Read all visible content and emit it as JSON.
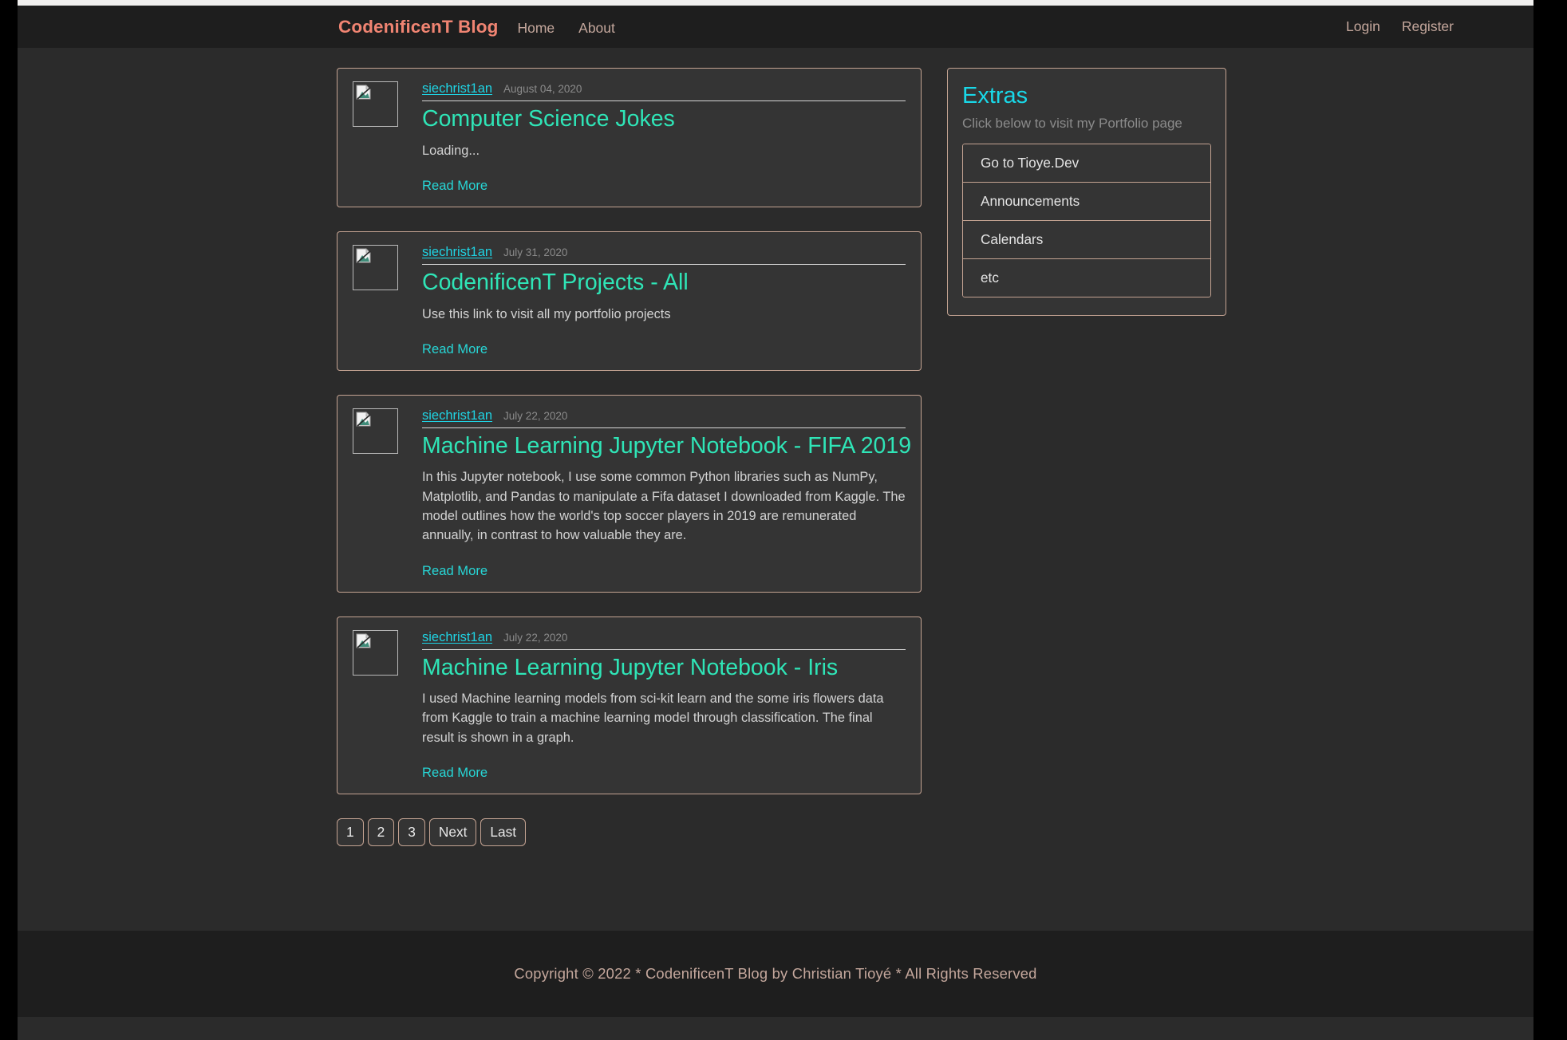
{
  "navbar": {
    "brand": "CodenificenT Blog",
    "left_links": [
      {
        "label": "Home",
        "name": "nav-link-home"
      },
      {
        "label": "About",
        "name": "nav-link-about"
      }
    ],
    "right_links": [
      {
        "label": "Login",
        "name": "nav-link-login"
      },
      {
        "label": "Register",
        "name": "nav-link-register"
      }
    ],
    "brand_color": "#f08472",
    "link_color": "#c4a79c",
    "background": "#1e1e1e"
  },
  "posts": [
    {
      "author": "siechrist1an",
      "date": "August 04, 2020",
      "title": "Computer Science Jokes",
      "excerpt": "Loading...",
      "read_more": "Read More",
      "thumbnail": "broken-image-icon"
    },
    {
      "author": "siechrist1an",
      "date": "July 31, 2020",
      "title": "CodenificenT Projects - All",
      "excerpt": "Use this link to visit all my portfolio projects",
      "read_more": "Read More",
      "thumbnail": "broken-image-icon"
    },
    {
      "author": "siechrist1an",
      "date": "July 22, 2020",
      "title": "Machine Learning Jupyter Notebook - FIFA 2019",
      "excerpt": "In this Jupyter notebook, I use some common Python libraries such as NumPy, Matplotlib, and Pandas to manipulate a Fifa dataset I downloaded from Kaggle. The model outlines how the world's top soccer players in 2019 are remunerated annually, in contrast to how valuable they are.",
      "read_more": "Read More",
      "thumbnail": "broken-image-icon"
    },
    {
      "author": "siechrist1an",
      "date": "July 22, 2020",
      "title": "Machine Learning Jupyter Notebook - Iris",
      "excerpt": "I used Machine learning models from sci-kit learn and the some iris flowers data from Kaggle to train a machine learning model through classification. The final result is shown in a graph.",
      "read_more": "Read More",
      "thumbnail": "broken-image-icon"
    }
  ],
  "pagination": {
    "buttons": [
      {
        "label": "1",
        "name": "page-1"
      },
      {
        "label": "2",
        "name": "page-2"
      },
      {
        "label": "3",
        "name": "page-3"
      },
      {
        "label": "Next",
        "name": "page-next"
      },
      {
        "label": "Last",
        "name": "page-last"
      }
    ]
  },
  "sidebar": {
    "title": "Extras",
    "subtitle": "Click below to visit my Portfolio page",
    "items": [
      {
        "label": "Go to Tioye.Dev",
        "name": "extras-item-tioye-dev"
      },
      {
        "label": "Announcements",
        "name": "extras-item-announcements"
      },
      {
        "label": "Calendars",
        "name": "extras-item-calendars"
      },
      {
        "label": "etc",
        "name": "extras-item-etc"
      }
    ],
    "title_color": "#19d8e8"
  },
  "footer": {
    "text": "Copyright © 2022 * CodenificenT Blog by Christian Tioyé * All Rights Reserved"
  },
  "theme": {
    "page_background": "#2b2b2b",
    "card_background": "#343434",
    "card_border": "#c4a392",
    "post_title_color": "#2fe5b7",
    "link_cyan": "#27d6d6",
    "muted_text": "#8b8b8b",
    "body_text": "#d2d2d2"
  }
}
